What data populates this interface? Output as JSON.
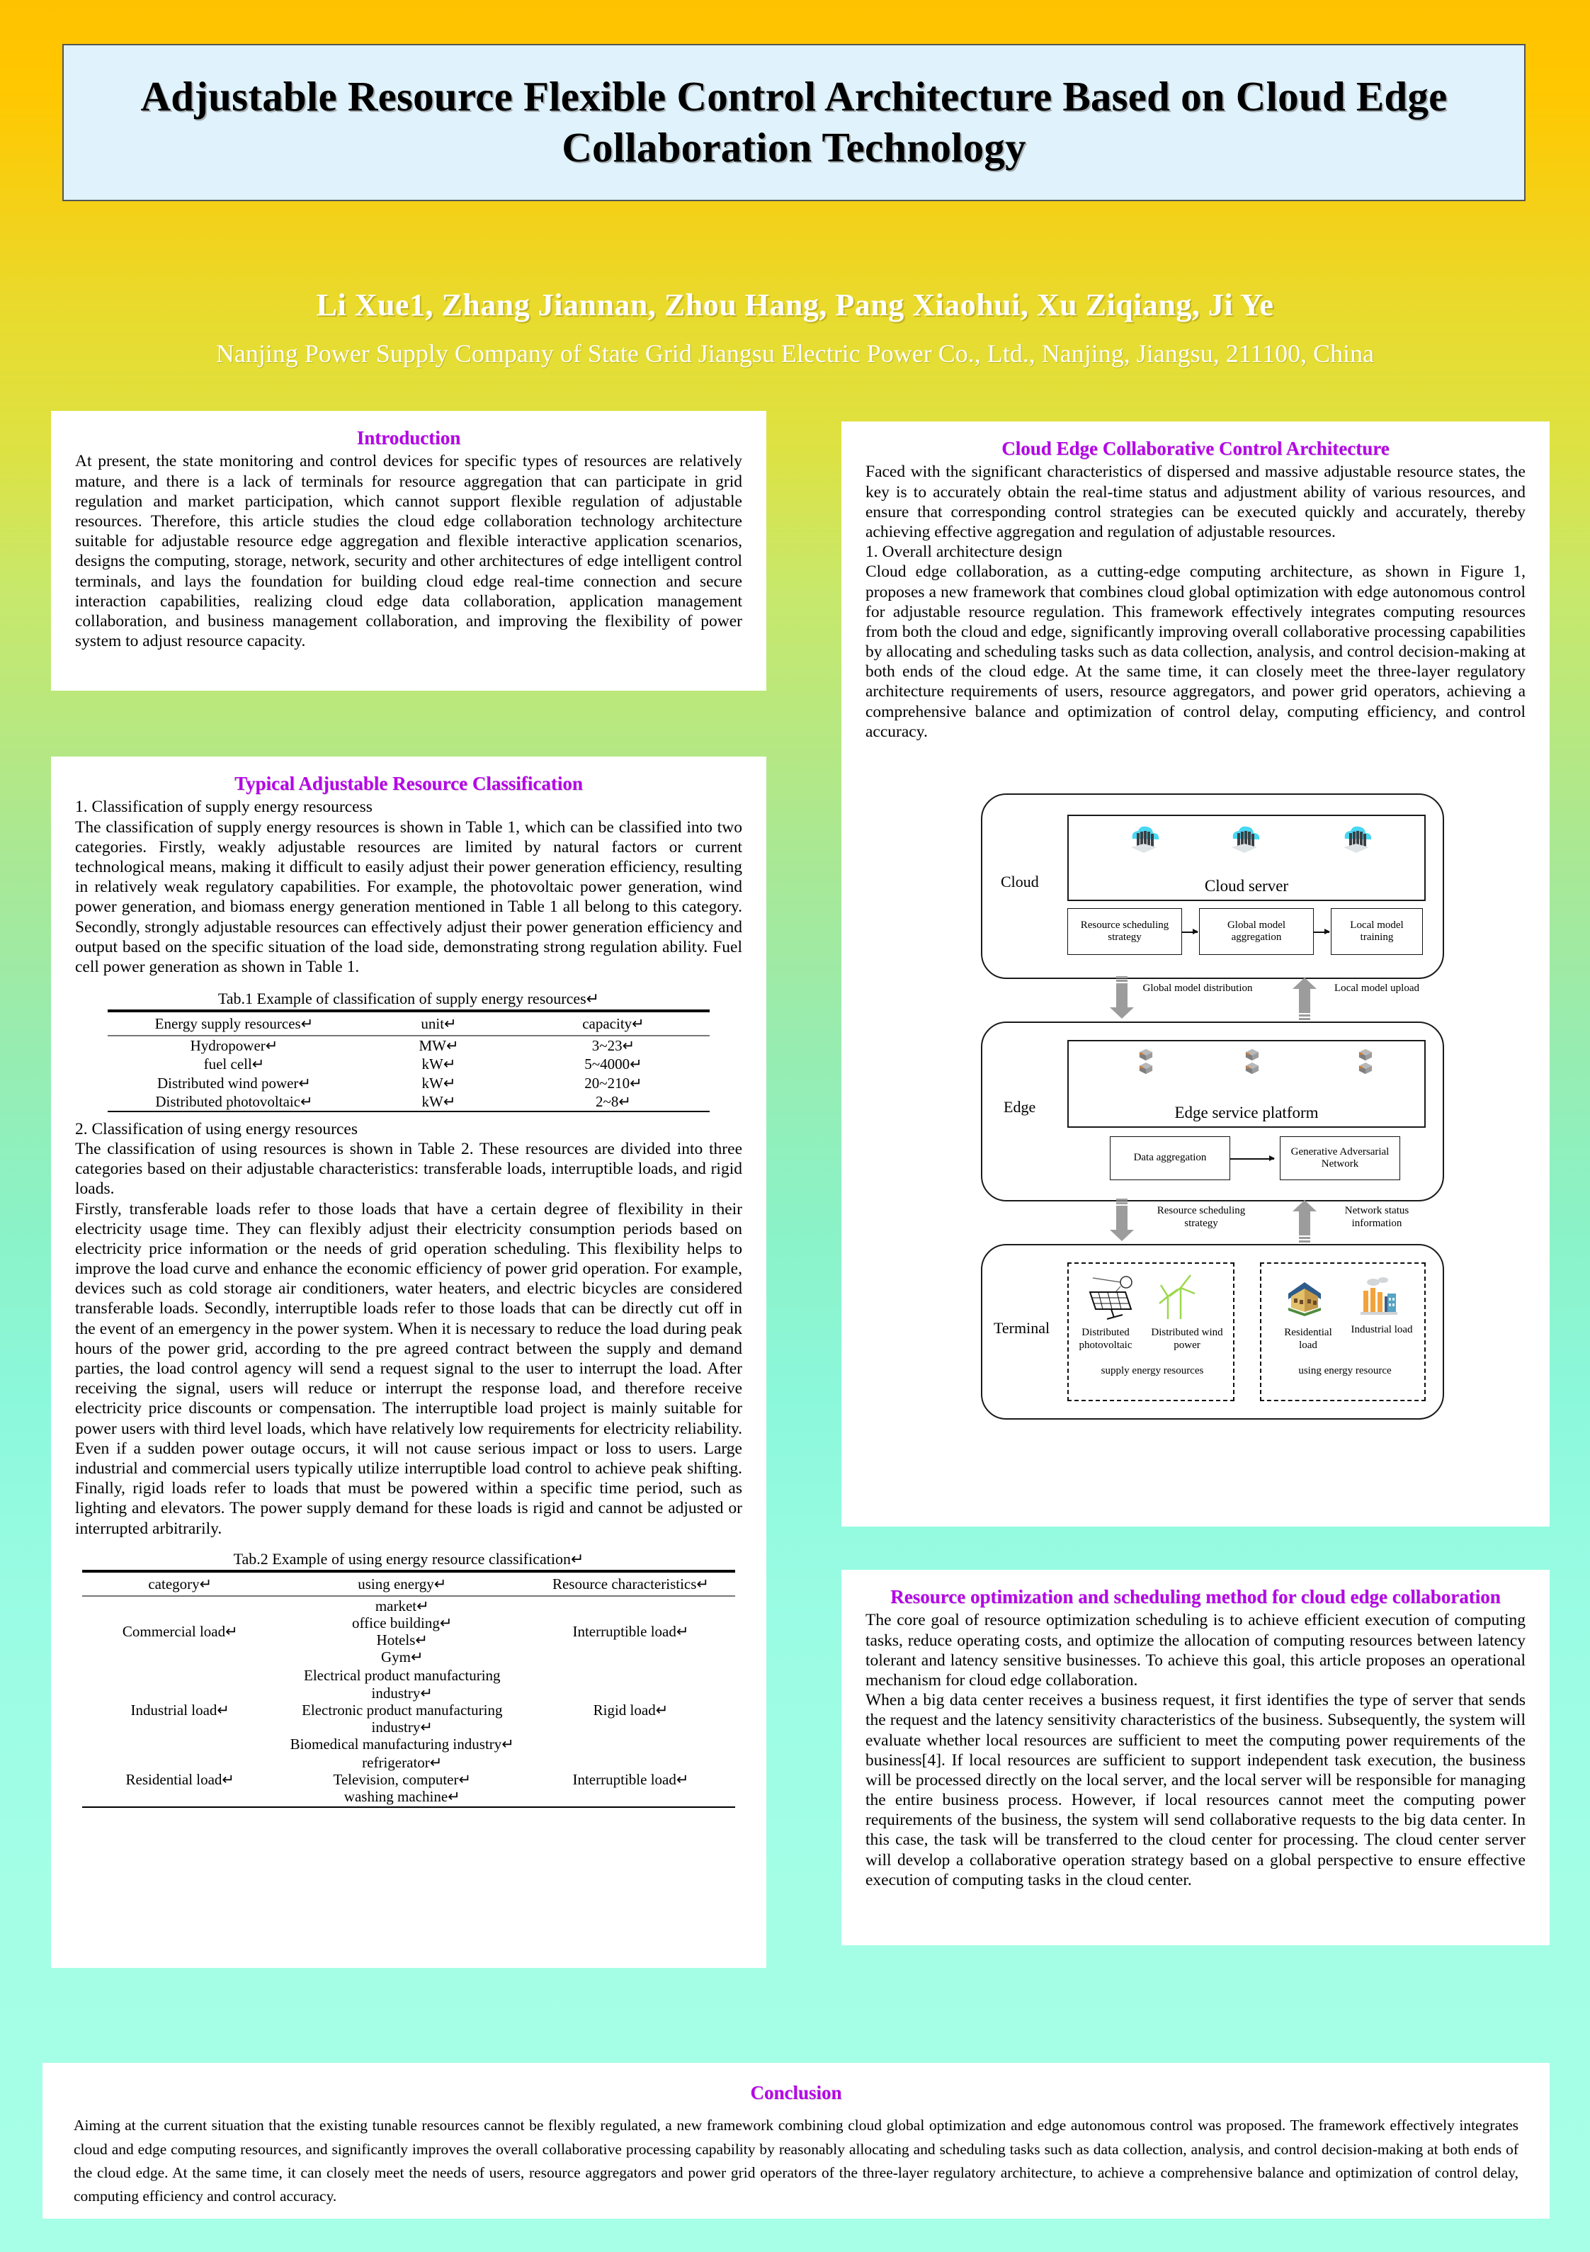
{
  "poster": {
    "title": "Adjustable Resource Flexible Control Architecture Based on Cloud Edge Collaboration Technology",
    "authors": "Li Xue1,  Zhang Jiannan,  Zhou Hang,  Pang Xiaohui,  Xu Ziqiang,  Ji Ye",
    "affiliation": "Nanjing Power Supply Company of State Grid Jiangsu Electric Power Co., Ltd., Nanjing, Jiangsu, 211100, China",
    "accent_heading_color": "#B500E8",
    "title_panel_color": "#E0F2FB"
  },
  "introduction": {
    "heading": "Introduction",
    "paragraph": "At present, the state monitoring and control devices for specific types of resources are relatively mature, and there is a lack of terminals for resource aggregation that can participate in grid regulation and market participation, which cannot support flexible regulation of adjustable resources. Therefore, this article studies the cloud edge collaboration technology architecture suitable for adjustable resource edge aggregation and flexible interactive application scenarios, designs the computing, storage, network, security and other architectures of edge intelligent control terminals, and lays the foundation for building cloud edge real-time connection and secure interaction capabilities, realizing cloud edge data collaboration, application management collaboration, and business management collaboration, and improving the flexibility of power system to adjust resource capacity."
  },
  "classification": {
    "heading": "Typical Adjustable Resource Classification",
    "sub1_title": "1.  Classification of supply energy resourcess",
    "sub1_paragraph": "The classification of supply energy resources is shown in Table 1, which can be classified into two categories. Firstly, weakly adjustable resources are limited by natural factors or current technological means, making it difficult to easily adjust their power generation efficiency, resulting in relatively weak regulatory capabilities. For example, the photovoltaic power generation, wind power generation, and biomass energy generation mentioned in Table 1 all belong to this category. Secondly, strongly adjustable resources can effectively adjust their power generation efficiency and output based on the specific situation of the load side, demonstrating strong regulation ability. Fuel cell power generation as shown in Table 1.",
    "sub2_title": "2.  Classification of using energy resources",
    "sub2_paragraph_a": "The classification of using resources is shown in Table 2. These resources are divided into three categories based on their adjustable characteristics: transferable loads, interruptible loads, and rigid loads.",
    "sub2_paragraph_b": "Firstly, transferable loads refer to those loads that have a certain degree of flexibility in their electricity usage time. They can flexibly adjust their electricity consumption periods based on electricity price information or the needs of grid operation scheduling. This flexibility helps to improve the load curve and enhance the economic efficiency of power grid operation. For example, devices such as cold storage air conditioners, water heaters, and electric bicycles are considered transferable loads. Secondly, interruptible loads refer to those loads that can be directly cut off in the event of an emergency in the power system. When it is necessary to reduce the load during peak hours of the power grid, according to the pre agreed contract between the supply and demand parties, the load control agency will send a request signal to the user to interrupt the load. After receiving the signal, users will reduce or interrupt the response load, and therefore receive electricity price discounts or compensation. The interruptible load project is mainly suitable for power users with third level loads, which have relatively low requirements for electricity reliability. Even if a sudden power outage occurs, it will not cause serious impact or loss to users. Large industrial and commercial users typically utilize interruptible load control to achieve peak shifting. Finally, rigid loads refer to loads that must be powered within a specific time period, such as lighting and elevators. The power supply demand for these loads is rigid and cannot be adjusted or interrupted arbitrarily."
  },
  "table1": {
    "caption": "Tab.1 Example of classification of supply energy resources↵",
    "columns": [
      "Energy supply resources↵",
      "unit↵",
      "capacity↵"
    ],
    "rows": [
      [
        "Hydropower↵",
        "MW↵",
        "3~23↵"
      ],
      [
        "fuel cell↵",
        "kW↵",
        "5~4000↵"
      ],
      [
        "Distributed wind power↵",
        "kW↵",
        "20~210↵"
      ],
      [
        "Distributed photovoltaic↵",
        "kW↵",
        "2~8↵"
      ]
    ]
  },
  "table2": {
    "caption": "Tab.2 Example of using energy resource classification↵",
    "columns": [
      "category↵",
      "using energy↵",
      "Resource characteristics↵"
    ],
    "rows": [
      {
        "category": "Commercial load↵",
        "using_energy": "market↵\noffice building↵\nHotels↵\nGym↵",
        "characteristics": "Interruptible load↵"
      },
      {
        "category": "Industrial load↵",
        "using_energy": "Electrical product manufacturing industry↵\nElectronic product manufacturing industry↵\nBiomedical manufacturing industry↵",
        "characteristics": "Rigid load↵"
      },
      {
        "category": "Residential load↵",
        "using_energy": "refrigerator↵\nTelevision, computer↵\nwashing machine↵",
        "characteristics": "Interruptible load↵"
      }
    ]
  },
  "architecture": {
    "heading": "Cloud Edge Collaborative Control Architecture",
    "paragraph_a": "Faced with the significant characteristics of dispersed and massive adjustable resource states, the key is to accurately obtain the real-time status and adjustment ability of various resources, and ensure that corresponding control strategies can be executed quickly and accurately, thereby achieving effective aggregation and regulation of adjustable resources.",
    "sub1_title": "1.  Overall architecture design",
    "paragraph_b": "Cloud edge collaboration, as a cutting-edge computing architecture, as shown in Figure 1, proposes a new framework that combines cloud global optimization with edge autonomous control for adjustable resource regulation. This framework effectively integrates computing resources from both the cloud and edge, significantly improving overall collaborative processing capabilities by allocating and scheduling tasks such as data collection, analysis, and control decision-making at both ends of the cloud edge. At the same time, it can closely meet the three-layer regulatory architecture requirements of users, resource aggregators, and power grid operators, achieving a comprehensive balance and optimization of control delay, computing efficiency, and control accuracy."
  },
  "figure": {
    "cloud_layer_label": "Cloud",
    "cloud_server_title": "Cloud server",
    "cloud_boxes": [
      "Resource scheduling strategy",
      "Global model aggregation",
      "Local model training"
    ],
    "arrow_down_1": "Global model distribution",
    "arrow_up_1": "Local model upload",
    "edge_layer_label": "Edge",
    "edge_platform_title": "Edge service platform",
    "edge_boxes": [
      "Data aggregation",
      "Generative Adversarial Network"
    ],
    "arrow_down_2": "Resource scheduling strategy",
    "arrow_up_2": "Network status information",
    "terminal_layer_label": "Terminal",
    "supply_group_label": "supply energy resources",
    "supply_items": [
      "Distributed photovoltaic",
      "Distributed wind power"
    ],
    "using_group_label": "using energy resource",
    "using_items": [
      "Residential load",
      "Industrial load"
    ]
  },
  "optimization": {
    "heading": "Resource optimization and scheduling method for cloud edge collaboration",
    "paragraph_a": "The core goal of resource optimization scheduling is to achieve efficient execution of computing tasks, reduce operating costs, and optimize the allocation of computing resources between latency tolerant and latency sensitive businesses. To achieve this goal, this article proposes an operational mechanism for cloud edge collaboration.",
    "paragraph_b": "When a big data center receives a business request, it first identifies the type of server that sends the request and the latency sensitivity characteristics of the business. Subsequently, the system will evaluate whether local resources are sufficient to meet the computing power requirements of the business[4]. If local resources are sufficient to support independent task execution, the business will be processed directly on the local server, and the local server will be responsible for managing the entire business process. However, if local resources cannot meet the computing power requirements of the business, the system will send collaborative requests to the big data center. In this case, the task will be transferred to the cloud center for processing. The cloud center server will develop a collaborative operation strategy based on a global perspective to ensure effective execution of computing tasks in the cloud center."
  },
  "conclusion": {
    "heading": "Conclusion",
    "paragraph": "Aiming at the current situation that the existing tunable resources cannot be flexibly regulated, a new framework combining cloud global optimization and edge autonomous control was proposed. The framework effectively integrates cloud and edge computing resources, and significantly improves the overall collaborative processing capability by reasonably allocating and scheduling tasks such as data collection, analysis, and control decision-making at both ends of the cloud edge. At the same time, it can closely meet the needs of users, resource aggregators and power grid operators of the three-layer regulatory architecture, to achieve a comprehensive balance and optimization of control delay, computing efficiency and control accuracy."
  }
}
